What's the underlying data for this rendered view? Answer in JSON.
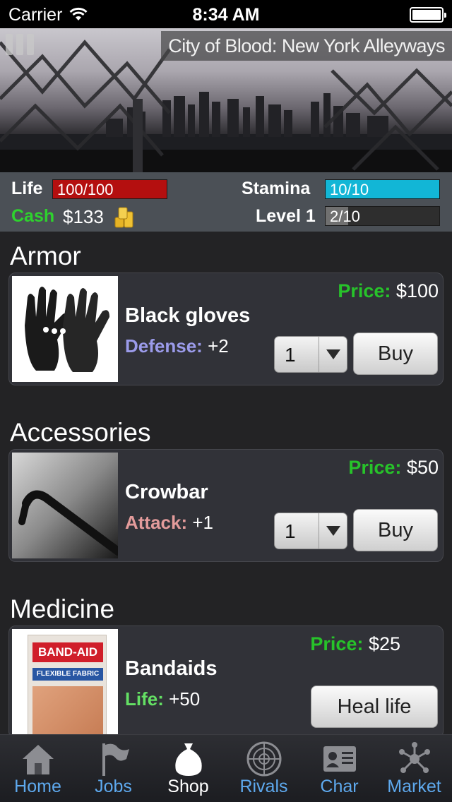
{
  "status_bar": {
    "carrier": "Carrier",
    "time": "8:34 AM"
  },
  "banner": {
    "location": "City of Blood: New York Alleyways"
  },
  "stats": {
    "life_label": "Life",
    "life_value": "100/100",
    "life_fraction": 1.0,
    "stamina_label": "Stamina",
    "stamina_value": "10/10",
    "stamina_fraction": 1.0,
    "cash_label": "Cash",
    "cash_value": "$133",
    "level_label": "Level 1",
    "level_value": "2/10",
    "level_fraction": 0.2
  },
  "colors": {
    "life_fill": "#b40f0f",
    "stamina_fill": "#12b6d6",
    "level_fill": "#707070",
    "cash_label": "#2ed22e",
    "price_label": "#27c32a",
    "defense": "#9b9bea",
    "attack": "#e39b9b",
    "life_stat": "#64e064",
    "tab_label": "#5ea9ee"
  },
  "sections": [
    {
      "title": "Armor",
      "item": {
        "name": "Black gloves",
        "stat_label": "Defense:",
        "stat_value": "+2",
        "price_label": "Price:",
        "price_value": "$100",
        "qty": "1",
        "button": "Buy"
      }
    },
    {
      "title": "Accessories",
      "item": {
        "name": "Crowbar",
        "stat_label": "Attack:",
        "stat_value": "+1",
        "price_label": "Price:",
        "price_value": "$50",
        "qty": "1",
        "button": "Buy"
      }
    },
    {
      "title": "Medicine",
      "item": {
        "name": "Bandaids",
        "stat_label": "Life:",
        "stat_value": "+50",
        "price_label": "Price:",
        "price_value": "$25",
        "button": "Heal life",
        "image_text": "BAND-AID",
        "image_subtext": "FLEXIBLE FABRIC"
      }
    }
  ],
  "tabs": [
    {
      "label": "Home",
      "icon": "home-icon"
    },
    {
      "label": "Jobs",
      "icon": "flag-icon"
    },
    {
      "label": "Shop",
      "icon": "money-bag-icon"
    },
    {
      "label": "Rivals",
      "icon": "radar-icon"
    },
    {
      "label": "Char",
      "icon": "id-card-icon"
    },
    {
      "label": "Market",
      "icon": "network-icon"
    }
  ],
  "active_tab": "Shop"
}
